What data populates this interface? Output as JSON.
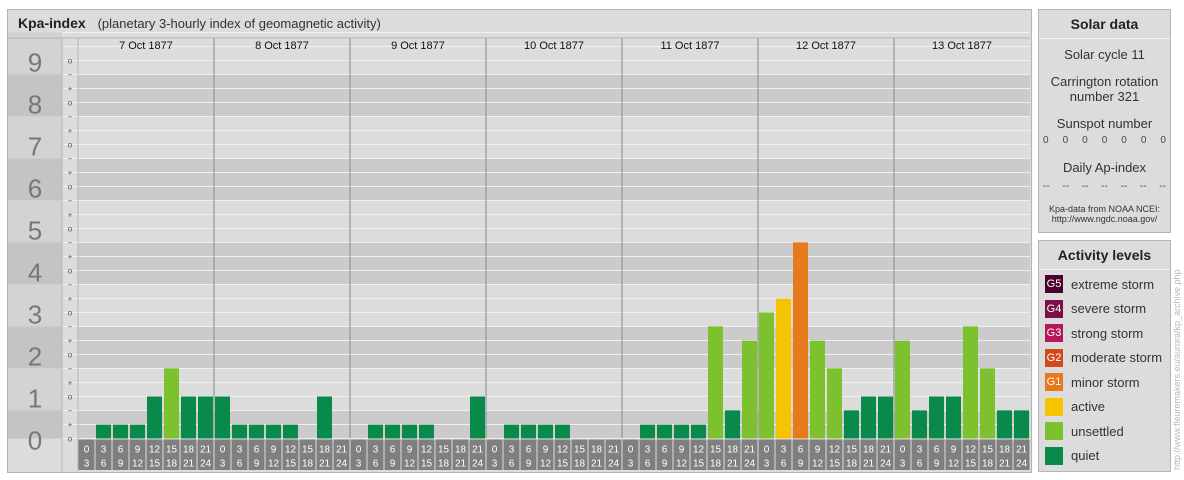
{
  "header": {
    "title": "Kpa-index",
    "subtitle": "(planetary 3-hourly index of geomagnetic activity)"
  },
  "chart_data": {
    "type": "bar",
    "title": "Kpa-index",
    "subtitle": "(planetary 3-hourly index of geomagnetic activity)",
    "days": [
      "7 Oct 1877",
      "8 Oct 1877",
      "9 Oct 1877",
      "10 Oct 1877",
      "11 Oct 1877",
      "12 Oct 1877",
      "13 Oct 1877"
    ],
    "interval_labels": [
      [
        "0",
        "3"
      ],
      [
        "3",
        "6"
      ],
      [
        "6",
        "9"
      ],
      [
        "9",
        "12"
      ],
      [
        "12",
        "15"
      ],
      [
        "15",
        "18"
      ],
      [
        "18",
        "21"
      ],
      [
        "21",
        "24"
      ]
    ],
    "values": [
      [
        0,
        0.33,
        0.33,
        0.33,
        1.0,
        1.67,
        1.0,
        1.0
      ],
      [
        1.0,
        0.33,
        0.33,
        0.33,
        0.33,
        0,
        1.0,
        0
      ],
      [
        0,
        0.33,
        0.33,
        0.33,
        0.33,
        0,
        0,
        1.0
      ],
      [
        0,
        0.33,
        0.33,
        0.33,
        0.33,
        0,
        0,
        0
      ],
      [
        0,
        0.33,
        0.33,
        0.33,
        0.33,
        2.67,
        0.67,
        2.33
      ],
      [
        3.0,
        3.33,
        4.67,
        2.33,
        1.67,
        0.67,
        1.0,
        1.0
      ],
      [
        2.33,
        0.67,
        1.0,
        1.0,
        2.67,
        1.67,
        0.67,
        0.67
      ]
    ],
    "y_ticks": [
      "0",
      "1",
      "2",
      "3",
      "4",
      "5",
      "6",
      "7",
      "8",
      "9"
    ],
    "minor_labels": [
      "o",
      "+",
      "−",
      "o",
      "+",
      "−",
      "o",
      "+",
      "−",
      "o",
      "+",
      "−",
      "o",
      "+",
      "−",
      "o",
      "+",
      "−",
      "o",
      "+",
      "−",
      "o",
      "+",
      "−",
      "o",
      "+",
      "−",
      "o"
    ],
    "ylim": [
      0,
      9.67
    ],
    "grid": true,
    "level_colors": {
      "quiet": "#0a8a4a",
      "unsettled": "#7cc22e",
      "active": "#f6c300",
      "G1": "#e87a1e",
      "G2": "#d4491c",
      "G3": "#b5175a",
      "G4": "#7b1049",
      "G5": "#4a0030"
    }
  },
  "solar": {
    "heading": "Solar data",
    "cycle": "Solar cycle 11",
    "carrington": "Carrington rotation number 321",
    "sunspot_label": "Sunspot number",
    "sunspot_values": [
      "0",
      "0",
      "0",
      "0",
      "0",
      "0",
      "0"
    ],
    "ap_label": "Daily Ap-index",
    "ap_values": [
      "--",
      "--",
      "--",
      "--",
      "--",
      "--",
      "--"
    ],
    "source_line1": "Kpa-data from NOAA NCEI:",
    "source_line2": "http://www.ngdc.noaa.gov/"
  },
  "activity": {
    "heading": "Activity levels",
    "items": [
      {
        "code": "G5",
        "label": "extreme storm",
        "color": "#4a0030"
      },
      {
        "code": "G4",
        "label": "severe storm",
        "color": "#7b1049"
      },
      {
        "code": "G3",
        "label": "strong storm",
        "color": "#b5175a"
      },
      {
        "code": "G2",
        "label": "moderate storm",
        "color": "#d4491c"
      },
      {
        "code": "G1",
        "label": "minor storm",
        "color": "#e87a1e"
      },
      {
        "code": "",
        "label": "active",
        "color": "#f6c300"
      },
      {
        "code": "",
        "label": "unsettled",
        "color": "#7cc22e"
      },
      {
        "code": "",
        "label": "quiet",
        "color": "#0a8a4a"
      }
    ]
  },
  "credit": "http://www.fleuremakers.eu/aurora/kp_archive.php"
}
